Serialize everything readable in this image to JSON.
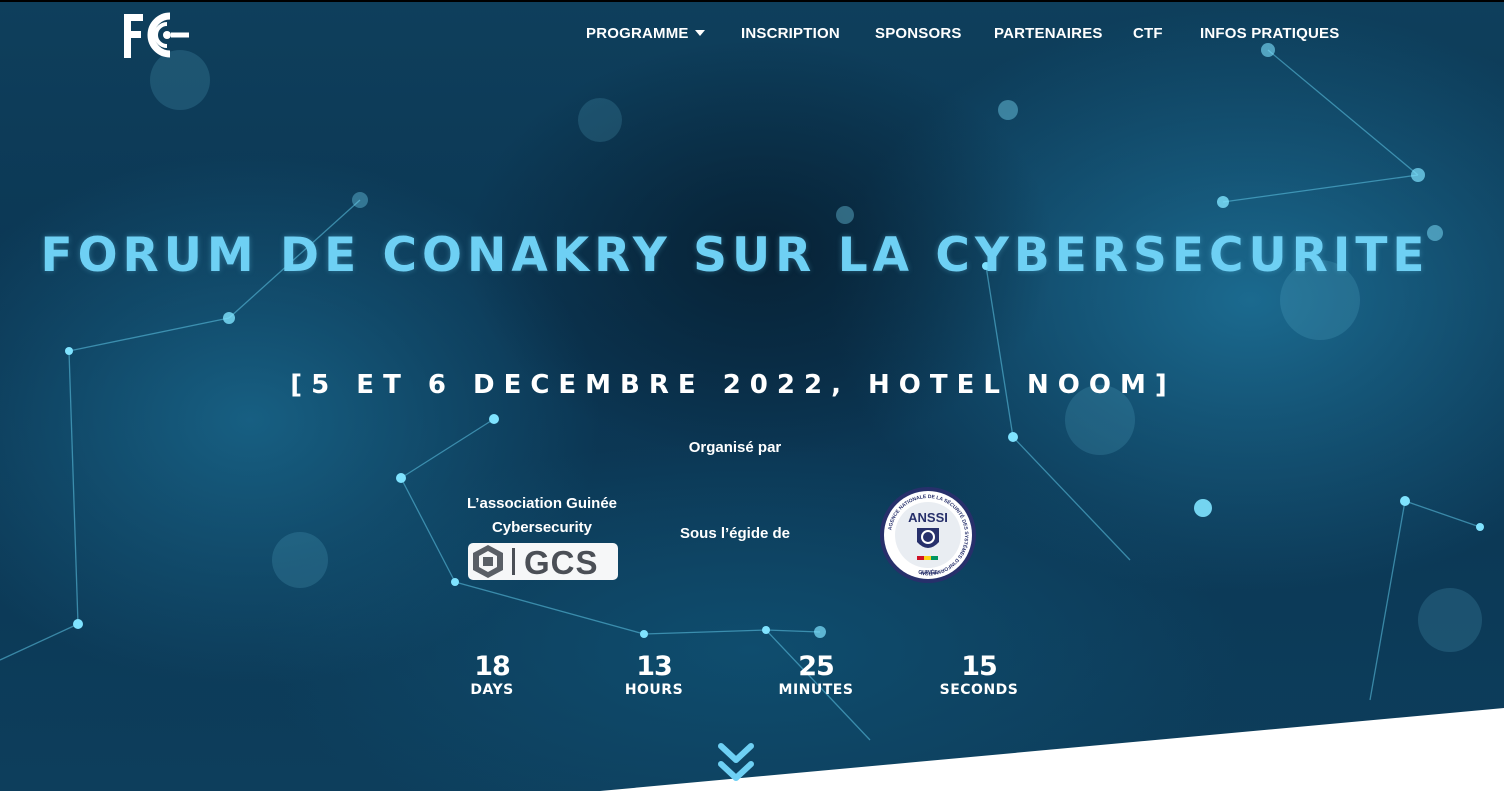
{
  "header": {
    "logo_text": "FC",
    "nav": [
      {
        "label": "PROGRAMME",
        "has_dropdown": true
      },
      {
        "label": "INSCRIPTION"
      },
      {
        "label": "SPONSORS"
      },
      {
        "label": "PARTENAIRES"
      },
      {
        "label": "CTF"
      },
      {
        "label": "INFOS PRATIQUES"
      }
    ]
  },
  "hero": {
    "title": "FORUM DE CONAKRY SUR LA CYBERSECURITE",
    "subtitle": "[5 ET 6 DECEMBRE 2022, HOTEL NOOM]",
    "organised_by": "Organisé par",
    "association": "L’association Guinée Cybersecurity",
    "gcs_logo_text": "GCS",
    "under_aegis": "Sous l’égide de",
    "anssi_logo_text": "ANSSI",
    "anssi_ring_text": "AGENCE NATIONALE DE LA SÉCURITÉ DES SYSTÈMES D'INFORMATION",
    "anssi_country": "GUINÉE"
  },
  "countdown": {
    "days": {
      "value": "18",
      "label": "DAYS"
    },
    "hours": {
      "value": "13",
      "label": "HOURS"
    },
    "minutes": {
      "value": "25",
      "label": "MINUTES"
    },
    "seconds": {
      "value": "15",
      "label": "SECONDS"
    }
  },
  "colors": {
    "title": "#6ed0f4",
    "background": "#0b3552",
    "nodes": "#7fe3ff"
  },
  "icons": {
    "dropdown": "caret-down-icon",
    "scroll": "double-chevron-down-icon"
  }
}
